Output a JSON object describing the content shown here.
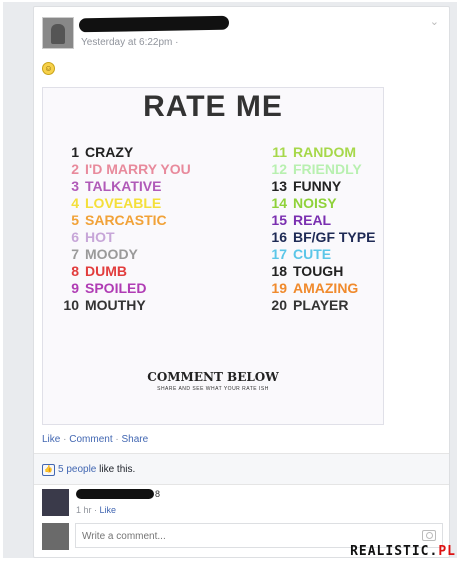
{
  "post": {
    "timestamp": "Yesterday at 6:22pm · ",
    "emoji": "☺"
  },
  "image": {
    "title": "RATE ME",
    "left_items": [
      {
        "n": "1",
        "label": "CRAZY",
        "color": "#222222"
      },
      {
        "n": "2",
        "label": "I'D MARRY YOU",
        "color": "#e88a9c"
      },
      {
        "n": "3",
        "label": "TALKATIVE",
        "color": "#b05ab8"
      },
      {
        "n": "4",
        "label": "LOVEABLE",
        "color": "#f4df3a"
      },
      {
        "n": "5",
        "label": "SARCASTIC",
        "color": "#f1a238"
      },
      {
        "n": "6",
        "label": "HOT",
        "color": "#c7a6d8"
      },
      {
        "n": "7",
        "label": "MOODY",
        "color": "#9a9a9a"
      },
      {
        "n": "8",
        "label": "DUMB",
        "color": "#e23d3d"
      },
      {
        "n": "9",
        "label": "SPOILED",
        "color": "#b03cb4"
      },
      {
        "n": "10",
        "label": "MOUTHY",
        "color": "#333333"
      }
    ],
    "right_items": [
      {
        "n": "11",
        "label": "RANDOM",
        "color": "#a6d84a"
      },
      {
        "n": "12",
        "label": "FRIENDLY",
        "color": "#b8f0b0"
      },
      {
        "n": "13",
        "label": "FUNNY",
        "color": "#222222"
      },
      {
        "n": "14",
        "label": "NOISY",
        "color": "#8fd23a"
      },
      {
        "n": "15",
        "label": "REAL",
        "color": "#7a2fb0"
      },
      {
        "n": "16",
        "label": "BF/GF TYPE",
        "color": "#1e2a55"
      },
      {
        "n": "17",
        "label": "CUTE",
        "color": "#5bc6e8"
      },
      {
        "n": "18",
        "label": "TOUGH",
        "color": "#222222"
      },
      {
        "n": "19",
        "label": "AMAZING",
        "color": "#f08a2c"
      },
      {
        "n": "20",
        "label": "PLAYER",
        "color": "#333333"
      }
    ],
    "cta": "COMMENT BELOW",
    "cta_sub": "SHARE AND SEE WHAT YOUR RATE ISH"
  },
  "actions": {
    "like": "Like",
    "comment": "Comment",
    "share": "Share",
    "sep": " · "
  },
  "likes": {
    "count": "5 people",
    "suffix": " like this."
  },
  "comment": {
    "trailing": "8",
    "age": "1 hr · ",
    "like": "Like"
  },
  "composer": {
    "placeholder": "Write a comment..."
  },
  "watermark": {
    "main": "REALISTIC.",
    "tld": "PL"
  }
}
